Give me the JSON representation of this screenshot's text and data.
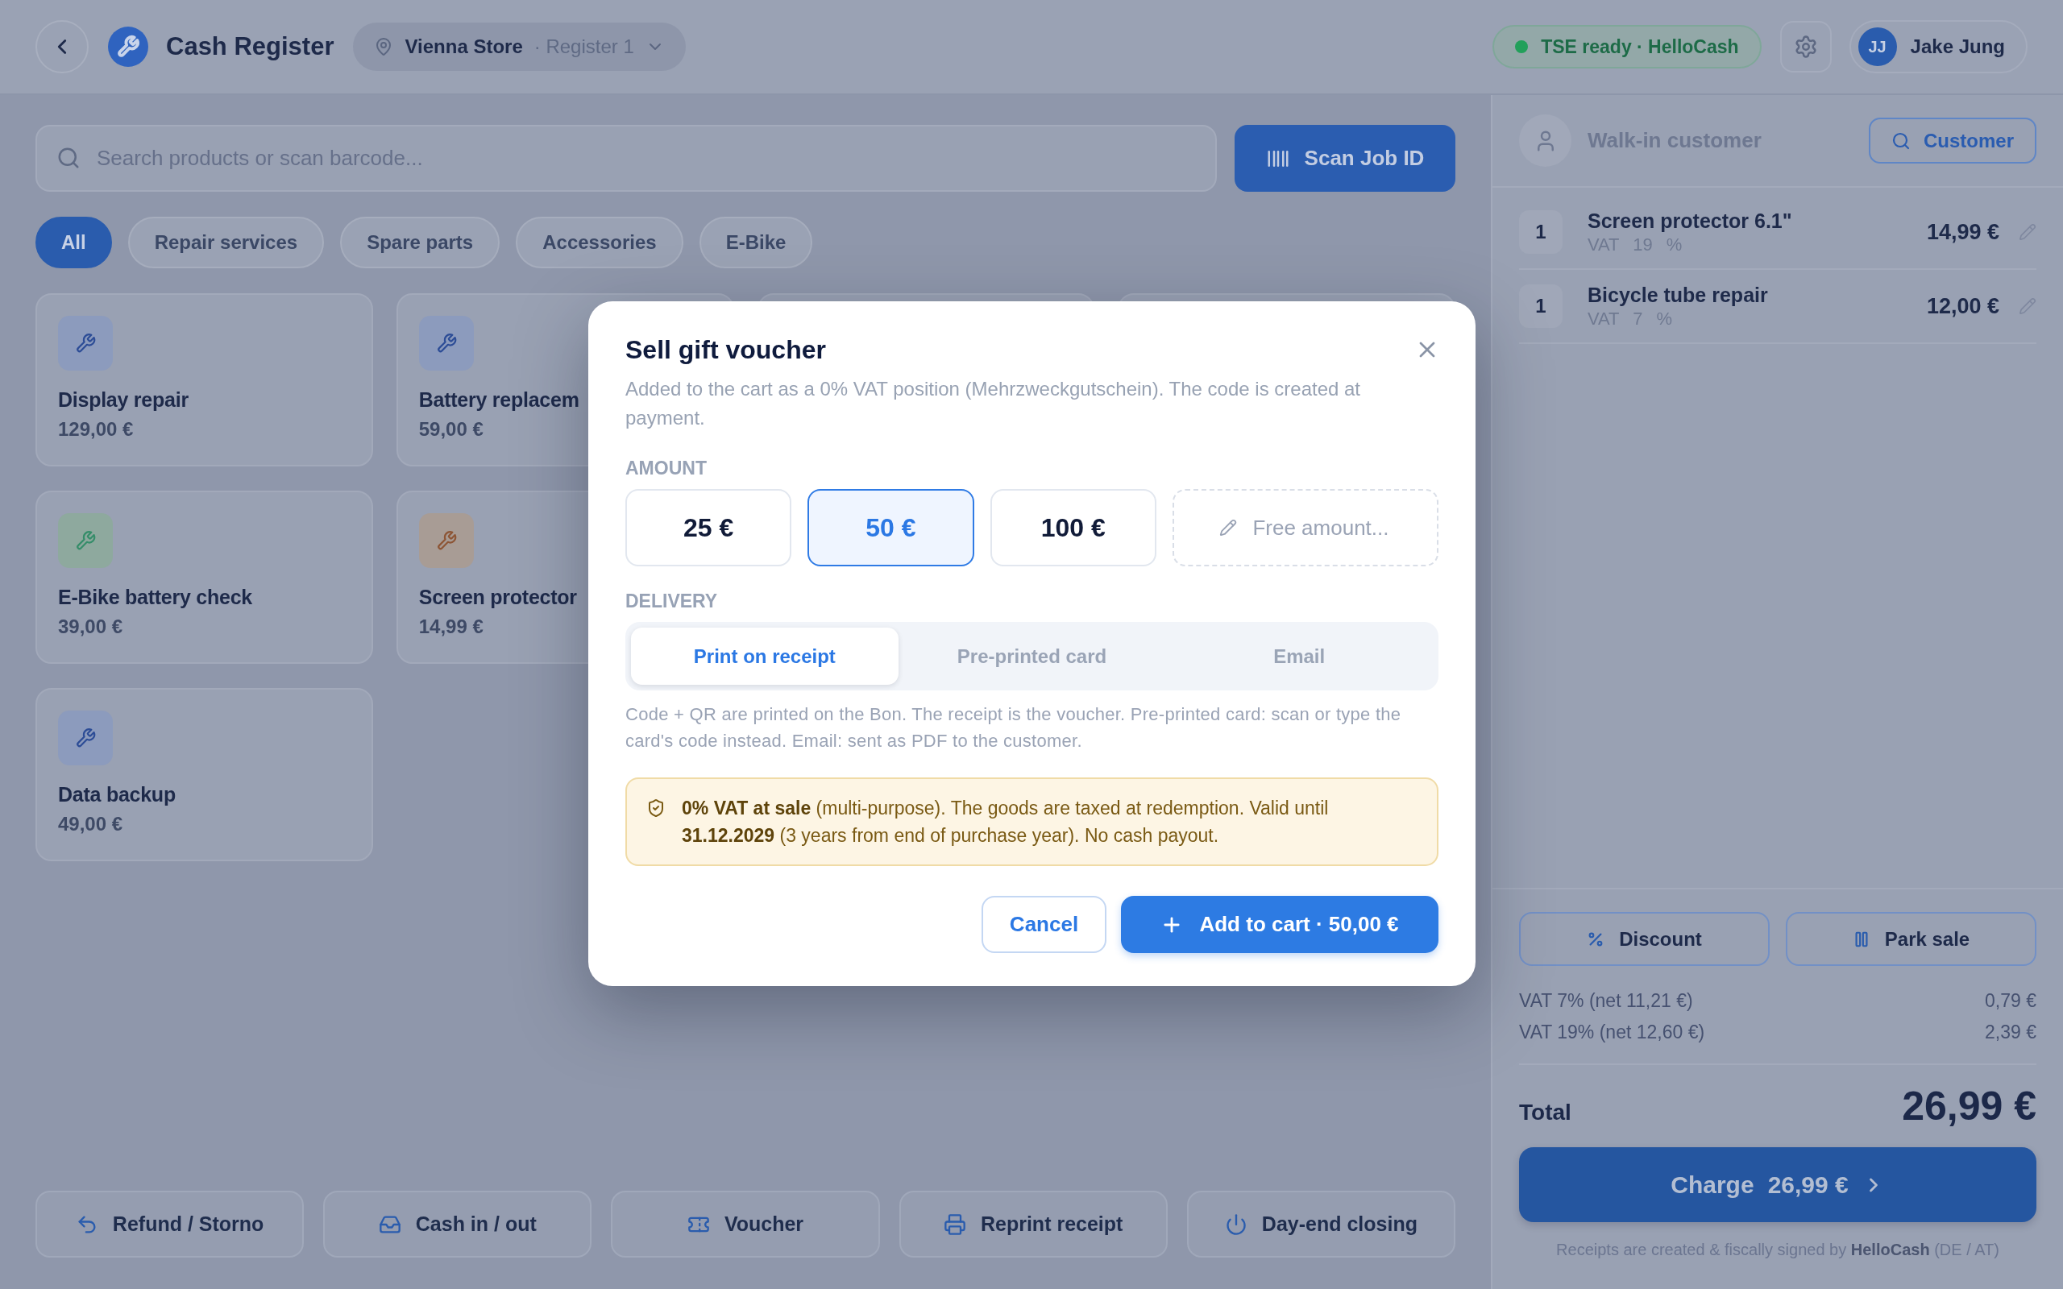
{
  "header": {
    "title": "Cash Register",
    "location": {
      "store": "Vienna Store",
      "register": "· Register 1"
    },
    "tse_status": "TSE ready · HelloCash",
    "user": {
      "initials": "JJ",
      "name": "Jake Jung"
    }
  },
  "search": {
    "placeholder": "Search products or scan barcode..."
  },
  "scan_button": "Scan Job ID",
  "categories": [
    {
      "label": "All",
      "selected": true
    },
    {
      "label": "Repair services",
      "selected": false
    },
    {
      "label": "Spare parts",
      "selected": false
    },
    {
      "label": "Accessories",
      "selected": false
    },
    {
      "label": "E-Bike",
      "selected": false
    }
  ],
  "product_rows": [
    [
      {
        "name": "Display repair",
        "price": "129,00 €",
        "color": "#8c9bbd"
      },
      {
        "name": "Battery replacem",
        "price": "59,00 €",
        "color": "#8c9bbd"
      }
    ],
    [
      {
        "name": "E-Bike battery check",
        "price": "39,00 €",
        "color": "#8ea99e"
      },
      {
        "name": "Screen protector",
        "price": "14,99 €",
        "color": "#a89c95"
      }
    ],
    [
      {
        "name": "Data backup",
        "price": "49,00 €",
        "color": "#8c9bbd"
      }
    ]
  ],
  "quick_actions": [
    {
      "kind": "refund",
      "label": "Refund / Storno"
    },
    {
      "kind": "cash",
      "label": "Cash in / out"
    },
    {
      "kind": "voucher",
      "label": "Voucher"
    },
    {
      "kind": "reprint",
      "label": "Reprint receipt"
    },
    {
      "kind": "closing",
      "label": "Day-end closing"
    }
  ],
  "cart": {
    "customer": {
      "name": "Walk-in customer",
      "button": "Customer"
    },
    "items": [
      {
        "qty": "1",
        "name": "Screen protector 6.1\"",
        "vat": "VAT 19 %",
        "price": "14,99 €"
      },
      {
        "qty": "1",
        "name": "Bicycle tube repair",
        "vat": "VAT 7 %",
        "price": "12,00 €"
      }
    ],
    "actions": [
      {
        "kind": "discount",
        "label": "Discount"
      },
      {
        "kind": "park",
        "label": "Park sale"
      }
    ],
    "tax_lines": [
      {
        "label": "VAT 7% (net 11,21 €)",
        "amount": "0,79 €"
      },
      {
        "label": "VAT 19% (net 12,60 €)",
        "amount": "2,39 €"
      }
    ],
    "total": {
      "label": "Total",
      "value": "26,99 €"
    },
    "charge": {
      "label": "Charge",
      "amount": "26,99 €"
    },
    "footer": "Receipts are created & fiscally signed by **HelloCash** (DE / AT)"
  },
  "voucher_dialog": {
    "title": "Sell gift voucher",
    "description": "Added to the cart as a 0% VAT position (Mehrzweckgutschein). The code is created at payment.",
    "amount_label": "AMOUNT",
    "amounts": [
      {
        "label": "25 €",
        "selected": false
      },
      {
        "label": "50 €",
        "selected": true
      },
      {
        "label": "100 €",
        "selected": false
      }
    ],
    "free_amount": {
      "placeholder": "Free amount..."
    },
    "delivery_label": "DELIVERY",
    "delivery_options": [
      {
        "label": "Print on receipt",
        "selected": true
      },
      {
        "label": "Pre-printed card",
        "selected": false
      },
      {
        "label": "Email",
        "selected": false
      }
    ],
    "delivery_help": "Code + QR are printed on the Bon. The receipt is the voucher. Pre-printed card: scan or type the card's code instead. Email: sent as PDF to the customer.",
    "notice": "**0% VAT at sale** (multi-purpose). The goods are taxed at redemption. Valid until **31.12.2029** (3 years from end of purchase year). No cash payout.",
    "cancel_button": "Cancel",
    "confirm_button": "Add to cart · 50,00 €"
  }
}
